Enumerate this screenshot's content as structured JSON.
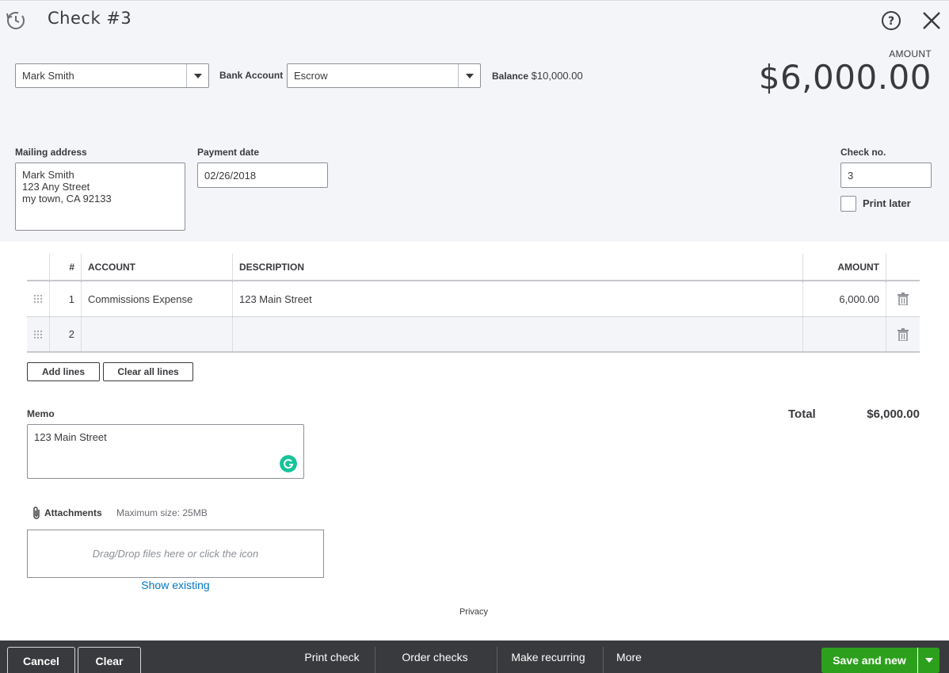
{
  "window": {
    "title": "Check #3"
  },
  "payee": {
    "value": "Mark Smith"
  },
  "bank_account": {
    "label": "Bank Account",
    "value": "Escrow"
  },
  "balance": {
    "label": "Balance",
    "value": "$10,000.00"
  },
  "amount": {
    "label": "AMOUNT",
    "value": "$6,000.00"
  },
  "mailing_address": {
    "label": "Mailing address",
    "lines": [
      "Mark Smith",
      "123 Any Street",
      "my town, CA  92133"
    ]
  },
  "payment_date": {
    "label": "Payment date",
    "value": "02/26/2018"
  },
  "check_no": {
    "label": "Check no.",
    "value": "3"
  },
  "print_later": {
    "label": "Print later",
    "checked": false
  },
  "table": {
    "headers": {
      "num": "#",
      "account": "ACCOUNT",
      "description": "DESCRIPTION",
      "amount": "AMOUNT"
    },
    "rows": [
      {
        "num": "1",
        "account": "Commissions Expense",
        "description": "123 Main Street",
        "amount": "6,000.00"
      },
      {
        "num": "2",
        "account": "",
        "description": "",
        "amount": ""
      }
    ]
  },
  "line_buttons": {
    "add": "Add lines",
    "clear": "Clear all lines"
  },
  "total": {
    "label": "Total",
    "value": "$6,000.00"
  },
  "memo": {
    "label": "Memo",
    "value": "123 Main Street"
  },
  "attachments": {
    "label": "Attachments",
    "max_size": "Maximum size: 25MB",
    "dropzone": "Drag/Drop files here or click the icon",
    "show_existing": "Show existing"
  },
  "privacy": "Privacy",
  "footer": {
    "cancel": "Cancel",
    "clear": "Clear",
    "print_check": "Print check",
    "order_checks": "Order checks",
    "make_recurring": "Make recurring",
    "more": "More",
    "save_new": "Save and new"
  },
  "colors": {
    "accent_green": "#2ca01c",
    "link_blue": "#0077c5",
    "footer_bg": "#393a3d",
    "header_bg": "#f4f5f8"
  }
}
